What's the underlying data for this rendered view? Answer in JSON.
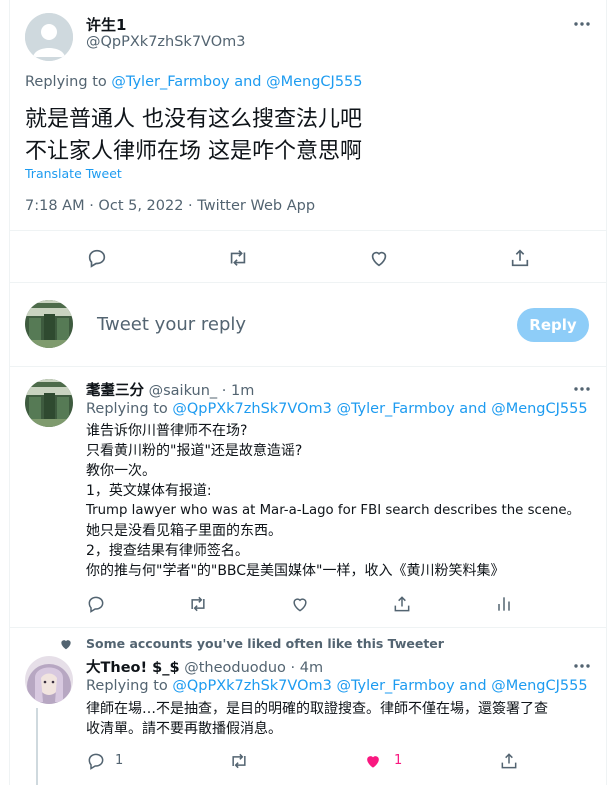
{
  "main_tweet": {
    "display_name": "许生1",
    "handle": "@QpPXk7zhSk7VOm3",
    "replying_prefix": "Replying to",
    "replying_to_1": "@Tyler_Farmboy",
    "replying_and": "and",
    "replying_to_2": "@MengCJ555",
    "text_line1": "就是普通人 也没有这么搜查法儿吧",
    "text_line2": "不让家人律师在场 这是咋个意思啊",
    "translate_label": "Translate Tweet",
    "timestamp": "7:18 AM · Oct 5, 2022 · Twitter Web App"
  },
  "compose": {
    "placeholder": "Tweet your reply",
    "reply_button": "Reply"
  },
  "reply1": {
    "display_name": "耄耋三分",
    "handle": "@saikun_",
    "time": "· 1m",
    "replying_prefix": "Replying to",
    "replying_to_1": "@QpPXk7zhSk7VOm3",
    "replying_to_2": "@Tyler_Farmboy",
    "replying_and": "and",
    "replying_to_3": "@MengCJ555",
    "lines": [
      "谁告诉你川普律师不在场?",
      "只看黄川粉的\"报道\"还是故意造谣?",
      "教你一次。",
      "1，英文媒体有报道:",
      "Trump lawyer who was at Mar-a-Lago for FBI search describes the scene。",
      "她只是没看见箱子里面的东西。",
      "2，搜查结果有律师签名。",
      "你的推与何\"学者\"的\"BBC是美国媒体\"一样，收入《黄川粉笑料集》"
    ]
  },
  "reply2": {
    "social_context": "Some accounts you've liked often like this Tweeter",
    "display_name": "大Theo! $_$",
    "handle": "@theoduoduo",
    "time": "· 4m",
    "replying_prefix": "Replying to",
    "replying_to_1": "@QpPXk7zhSk7VOm3",
    "replying_to_2": "@Tyler_Farmboy",
    "replying_and": "and",
    "replying_to_3": "@MengCJ555",
    "line1": "律師在場…不是抽查，是目的明確的取證搜查。律師不僅在場，還簽署了查",
    "line2": "收清單。請不要再散播假消息。",
    "reply_count": "1",
    "like_count": "1"
  },
  "colors": {
    "accent": "#1d9bf0",
    "like": "#f91880",
    "muted": "#536471",
    "reply_button_disabled": "#8ecdf8"
  }
}
